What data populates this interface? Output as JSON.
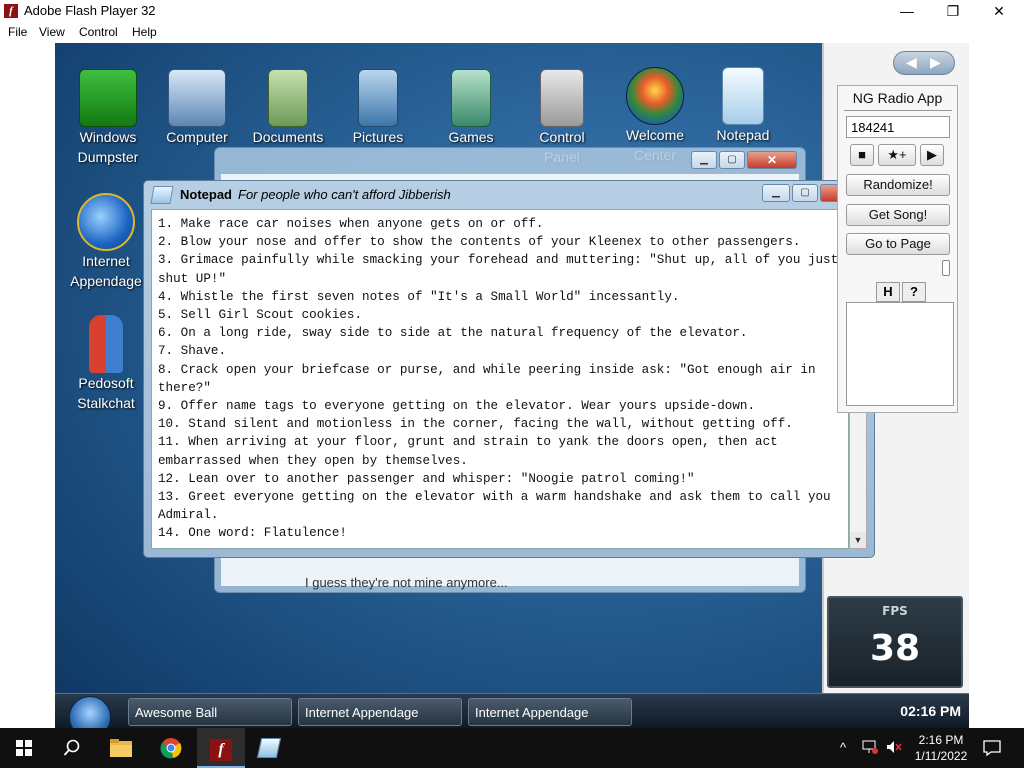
{
  "window": {
    "title": "Adobe Flash Player 32",
    "icon": "flash-icon",
    "minimize": "—",
    "maximize": "❐",
    "close": "✕"
  },
  "menu": [
    "File",
    "View",
    "Control",
    "Help"
  ],
  "desktop_icons": [
    {
      "label": "Windows\nDumpster",
      "icon": "dumpster-icon"
    },
    {
      "label": "Computer",
      "icon": "computer-icon"
    },
    {
      "label": "Documents",
      "icon": "documents-icon"
    },
    {
      "label": "Pictures",
      "icon": "pictures-icon"
    },
    {
      "label": "Games",
      "icon": "games-icon"
    },
    {
      "label": "Control\nPanel",
      "icon": "control-panel-icon"
    },
    {
      "label": "Welcome\nCenter",
      "icon": "welcome-center-icon"
    },
    {
      "label": "Notepad",
      "icon": "notepad-icon"
    },
    {
      "label": "Internet\nAppendage",
      "icon": "internet-appendage-icon"
    },
    {
      "label": "Pedosoft\nStalkchat",
      "icon": "stalkchat-icon"
    }
  ],
  "background_window": {
    "footer_text": "I guess they're not mine anymore..."
  },
  "notepad": {
    "app_name": "Notepad",
    "subtitle": "For people who can't afford Jibberish",
    "lines": [
      "1. Make race car noises when anyone gets on or off.",
      "2. Blow your nose and offer to show the contents of your Kleenex to other passengers.",
      "3. Grimace painfully while smacking your forehead and muttering: \"Shut up, all of you just shut UP!\"",
      "4. Whistle the first seven notes of \"It's a Small World\" incessantly.",
      "5. Sell Girl Scout cookies.",
      "6. On a long ride, sway side to side at the natural frequency of the elevator.",
      "7. Shave.",
      "8. Crack open your briefcase or purse, and while peering inside ask: \"Got enough air in there?\"",
      "9. Offer name tags to everyone getting on the elevator. Wear yours upside-down.",
      "10. Stand silent and motionless in the corner, facing the wall, without getting off.",
      "11. When arriving at your floor, grunt and strain to yank the doors open, then act embarrassed when they open by themselves.",
      "12. Lean over to another passenger and whisper: \"Noogie patrol coming!\"",
      "13. Greet everyone getting on the elevator with a warm handshake and ask them to call you Admiral.",
      "14. One word: Flatulence!"
    ]
  },
  "radio": {
    "title": "NG Radio App",
    "song_id": "184241",
    "stop": "■",
    "favorite": "★+",
    "play": "▶",
    "randomize": "Randomize!",
    "get_song": "Get Song!",
    "go_to_page": "Go to Page",
    "tab_h": "H",
    "tab_help": "?"
  },
  "nav": {
    "back": "◀",
    "forward": "▶"
  },
  "fps": {
    "label": "FPS",
    "value": "38"
  },
  "virtual_taskbar": {
    "buttons": [
      "Awesome Ball",
      "Internet Appendage",
      "Internet Appendage"
    ],
    "clock": "02:16 PM"
  },
  "windows_taskbar": {
    "time": "2:16 PM",
    "date": "1/11/2022",
    "tray_up": "^"
  }
}
